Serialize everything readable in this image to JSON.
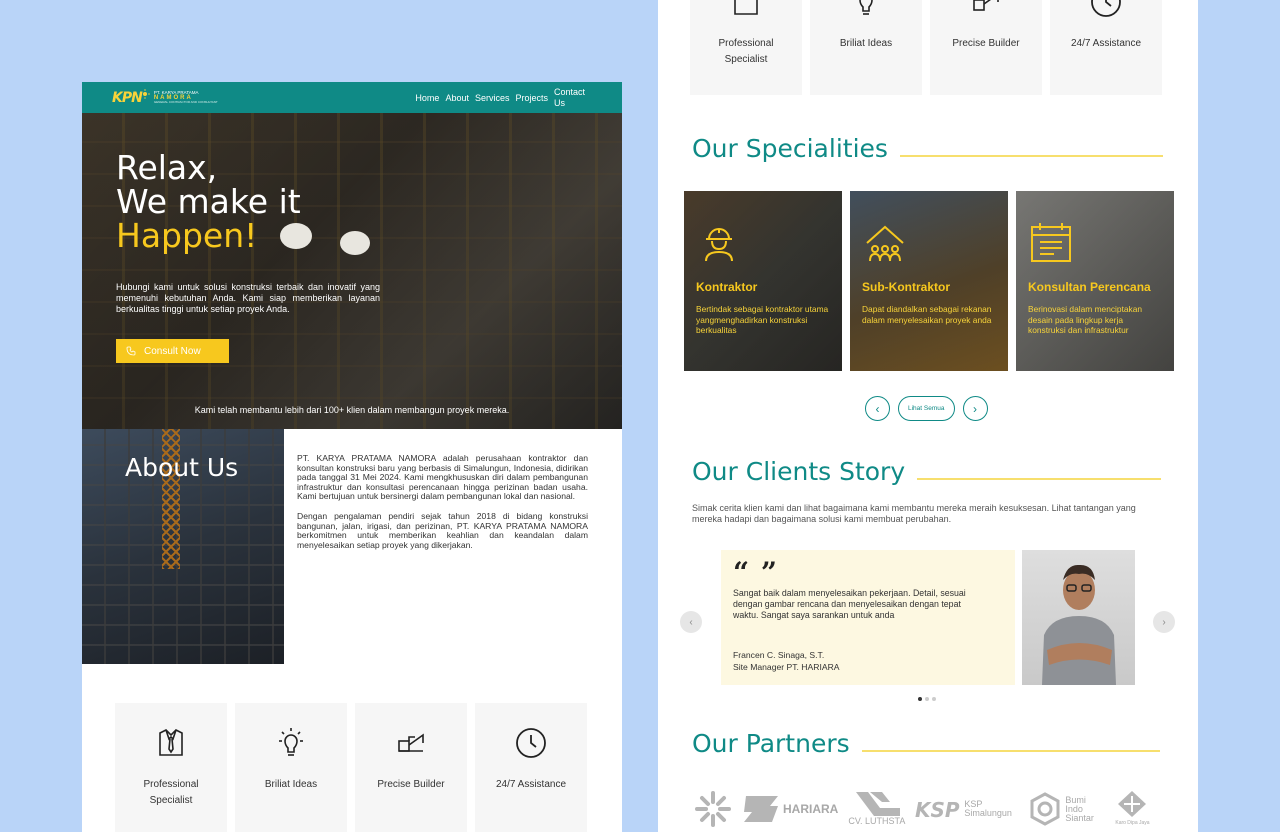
{
  "left_page": {
    "nav": {
      "logo_mark": "KPN",
      "logo_line1": "PT. KARYA PRATAMA",
      "logo_line2": "NAMORA",
      "logo_line3": "GENERAL CONTRACTOR AND CONSULTANT",
      "links": [
        "Home",
        "About",
        "Services",
        "Projects",
        "Contact Us"
      ]
    },
    "hero": {
      "title_line1": "Relax,",
      "title_line2": "We make it",
      "title_highlight": "Happen!",
      "description": "Hubungi kami untuk solusi konstruksi terbaik dan inovatif yang memenuhi kebutuhan Anda. Kami siap memberikan layanan berkualitas tinggi untuk setiap proyek Anda.",
      "cta_label": "Consult Now",
      "bottom_text": "Kami telah membantu lebih dari 100+ klien dalam membangun proyek mereka."
    },
    "about": {
      "title": "About Us",
      "paragraph1": "PT. KARYA PRATAMA NAMORA adalah perusahaan kontraktor dan konsultan konstruksi baru yang berbasis di Simalungun, Indonesia, didirikan pada tanggal 31 Mei 2024. Kami mengkhususkan diri dalam pembangunan infrastruktur dan konsultasi perencanaan hingga perizinan badan usaha. Kami bertujuan untuk bersinergi dalam pembangunan lokal dan nasional.",
      "paragraph2": "Dengan pengalaman pendiri sejak tahun 2018 di bidang konstruksi bangunan, jalan, irigasi, dan perizinan, PT. KARYA PRATAMA NAMORA berkomitmen untuk memberikan keahlian dan keandalan dalam menyelesaikan setiap proyek yang dikerjakan."
    },
    "features": [
      {
        "label": "Professional Specialist",
        "icon": "suit-tie-icon"
      },
      {
        "label": "Briliat Ideas",
        "icon": "lightbulb-icon"
      },
      {
        "label": "Precise Builder",
        "icon": "crane-icon"
      },
      {
        "label": "24/7 Assistance",
        "icon": "clock-icon"
      }
    ]
  },
  "right_page": {
    "features": [
      {
        "label": "Professional Specialist",
        "icon": "suit-tie-icon"
      },
      {
        "label": "Briliat Ideas",
        "icon": "lightbulb-icon"
      },
      {
        "label": "Precise Builder",
        "icon": "crane-icon"
      },
      {
        "label": "24/7 Assistance",
        "icon": "clock-icon"
      }
    ],
    "specialities": {
      "title": "Our Specialities",
      "cards": [
        {
          "title": "Kontraktor",
          "text": "Bertindak sebagai kontraktor utama yangmenghadirkan konstruksi berkualitas",
          "icon": "worker-helmet-icon"
        },
        {
          "title": "Sub-Kontraktor",
          "text": "Dapat diandalkan sebagai rekanan dalam menyelesaikan proyek anda",
          "icon": "team-house-icon"
        },
        {
          "title": "Konsultan Perencana",
          "text": "Berinovasi dalam menciptakan desain pada lingkup kerja konstruksi dan infrastruktur",
          "icon": "calendar-plan-icon"
        }
      ],
      "see_all_label": "Lihat Semua"
    },
    "clients": {
      "title": "Our Clients Story",
      "description": "Simak cerita klien kami dan lihat bagaimana kami membantu mereka meraih kesuksesan. Lihat tantangan yang mereka hadapi dan bagaimana solusi kami membuat perubahan.",
      "testimonial": {
        "quote": "Sangat baik dalam menyelesaikan pekerjaan. Detail, sesuai dengan gambar rencana dan menyelesaikan dengan tepat waktu. Sangat saya sarankan untuk anda",
        "name": "Francen C. Sinaga, S.T.",
        "role": "Site Manager PT. HARIARA"
      },
      "slide_count": 3,
      "active_slide": 1
    },
    "partners": {
      "title": "Our Partners",
      "logos": [
        {
          "name": "",
          "icon": "sunburst-logo-icon"
        },
        {
          "name": "HARIARA",
          "icon": "hariara-logo-icon"
        },
        {
          "name": "CV. LUTHSTA",
          "icon": "luthsta-logo-icon"
        },
        {
          "name": "KSP",
          "sub": "KSP Simalungun",
          "icon": "ksp-logo-icon"
        },
        {
          "name": "Bumi Indo Siantar",
          "icon": "hexagon-logo-icon"
        },
        {
          "name": "Karo Dipa Jaya",
          "icon": "diamond-logo-icon"
        }
      ]
    }
  },
  "colors": {
    "teal": "#0f8a86",
    "yellow": "#f7c81e",
    "background": "#b9d4f8",
    "cream": "#fdf8e1"
  }
}
